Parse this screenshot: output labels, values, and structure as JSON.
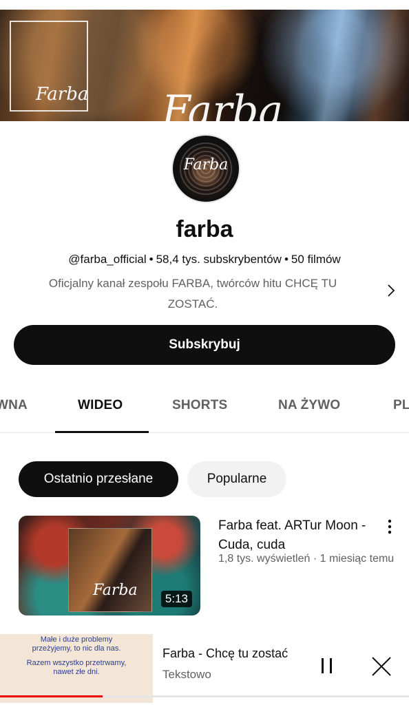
{
  "channel": {
    "name": "farba",
    "handle": "@farba_official",
    "subscribers": "58,4 tys. subskrybentów",
    "videos": "50 filmów",
    "description": "Oficjalny kanał zespołu FARBA, twórców hitu CHCĘ TU ZOSTAĆ.",
    "banner_script_small": "Farba",
    "banner_script_big": "Farba",
    "avatar_script": "Farba",
    "subscribe_label": "Subskrybuj"
  },
  "tabs": [
    {
      "label": "WNA"
    },
    {
      "label": "WIDEO",
      "active": true
    },
    {
      "label": "SHORTS"
    },
    {
      "label": "NA ŻYWO"
    },
    {
      "label": "PL"
    }
  ],
  "chips": [
    {
      "label": "Ostatnio przesłane",
      "active": true
    },
    {
      "label": "Popularne"
    }
  ],
  "videos": [
    {
      "title": "Farba feat. ARTur Moon - Cuda, cuda",
      "meta": "1,8 tys. wyświetleń · 1 miesiąc temu",
      "duration": "5:13",
      "thumb_script": "Farba"
    }
  ],
  "miniplayer": {
    "title": "Farba - Chcę tu zostać",
    "channel": "Tekstowo",
    "thumb_lines": [
      "Małe i duże problemy",
      "przeżyjemy, to nic dla nas.",
      "",
      "Razem wszystko przetrwamy,",
      "nawet złe dni."
    ],
    "progress": 0.25
  },
  "icons": {
    "chevron": "chevron-right-icon",
    "kebab": "more-vert-icon",
    "pause": "pause-icon",
    "close": "close-icon"
  },
  "colors": {
    "accent": "#0f0f0f",
    "progress": "#ee0000",
    "secondary_text": "#606060"
  }
}
